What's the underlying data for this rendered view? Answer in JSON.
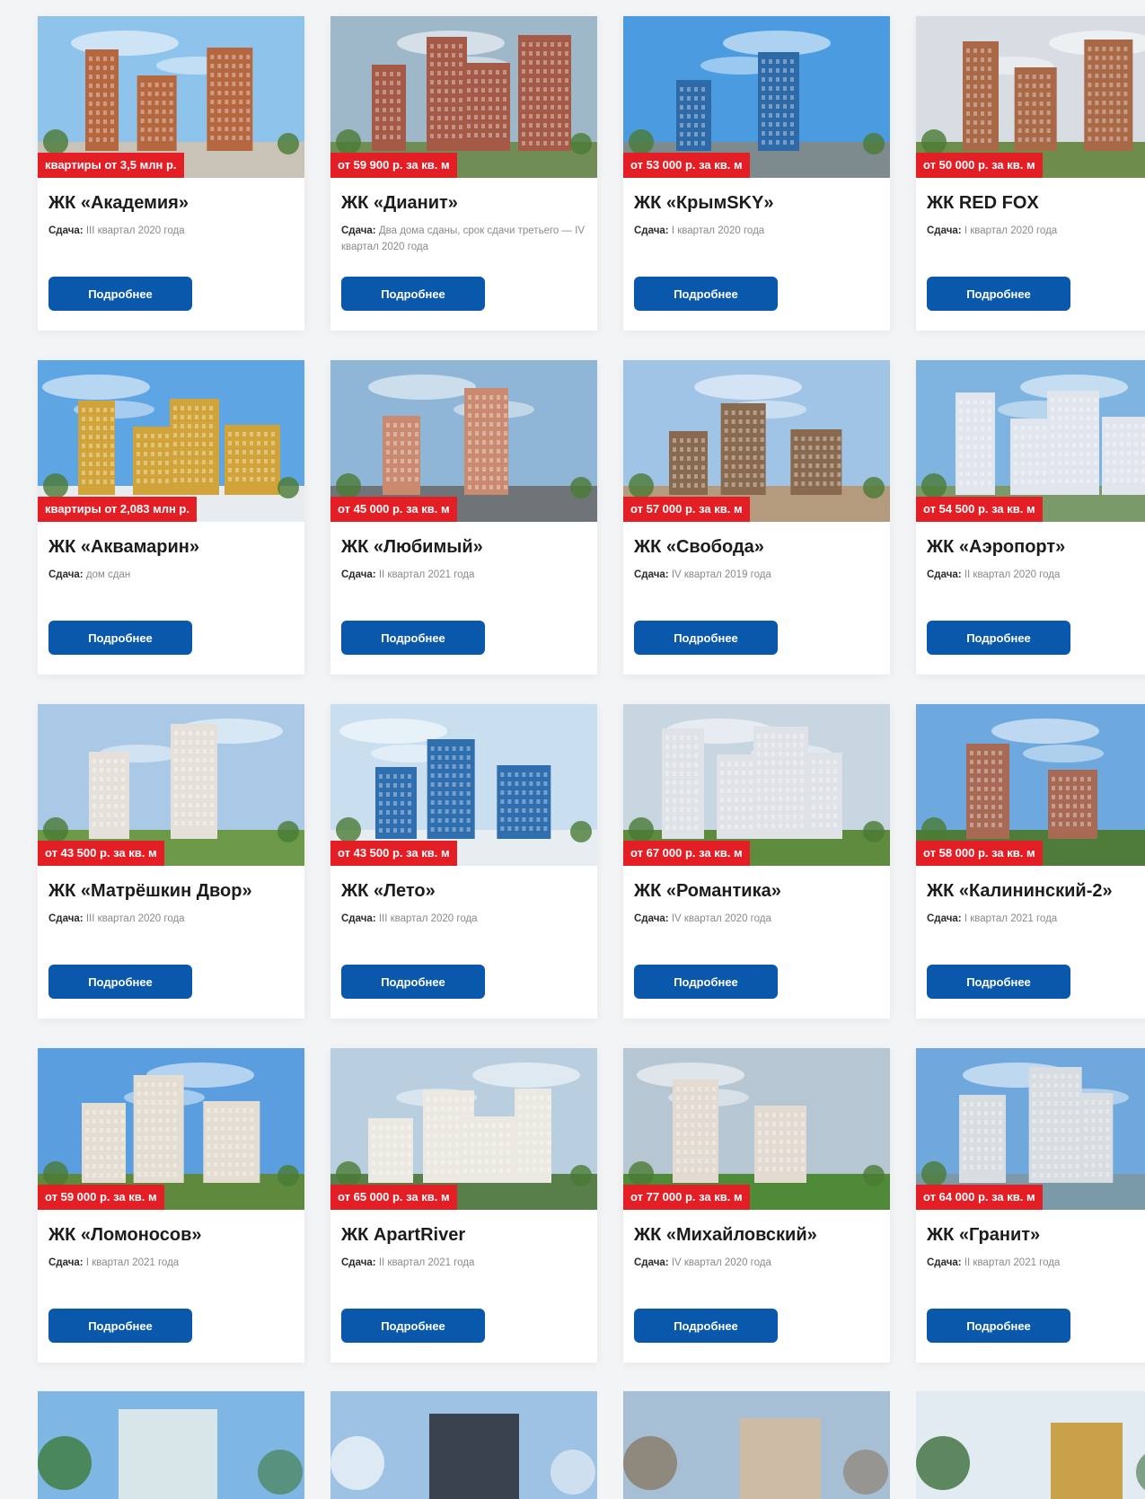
{
  "details_label": "Подробнее",
  "status_label": "Сдача:",
  "cards": [
    {
      "title": "ЖК «Академия»",
      "price": "квартиры от 3,5 млн р.",
      "status": "III квартал 2020 года",
      "sky": "#8ec3ec",
      "ground": "#c9c2b6",
      "building": "#b5673f"
    },
    {
      "title": "ЖК «Дианит»",
      "price": "от 59 900 р. за кв. м",
      "status": "Два дома сданы, срок сдачи третьего — IV квартал 2020 года",
      "sky": "#9fb8c9",
      "ground": "#6f8d55",
      "building": "#a45a46"
    },
    {
      "title": "ЖК «КрымSKY»",
      "price": "от 53 000 р. за кв. м",
      "status": "I квартал 2020 года",
      "sky": "#4a9be0",
      "ground": "#7d8a8e",
      "building": "#2f6aa8"
    },
    {
      "title": "ЖК RED FOX",
      "price": "от 50 000 р. за кв. м",
      "status": "I квартал 2020 года",
      "sky": "#d7dde2",
      "ground": "#6e8c4a",
      "building": "#a96846"
    },
    {
      "title": "ЖК «Аквамарин»",
      "price": "квартиры от 2,083 млн р.",
      "status": "дом сдан",
      "sky": "#5ea5e3",
      "ground": "#e8ecef",
      "building": "#d1a43a"
    },
    {
      "title": "ЖК «Любимый»",
      "price": "от 45 000 р. за кв. м",
      "status": "II квартал 2021 года",
      "sky": "#8fb6d6",
      "ground": "#6f7479",
      "building": "#c98a6f"
    },
    {
      "title": "ЖК «Свобода»",
      "price": "от 57 000 р. за кв. м",
      "status": "IV квартал 2019 года",
      "sky": "#9fc4e6",
      "ground": "#b49b7e",
      "building": "#8a6a4e"
    },
    {
      "title": "ЖК «Аэропорт»",
      "price": "от 54 500 р. за кв. м",
      "status": "II квартал 2020 года",
      "sky": "#7fb3e0",
      "ground": "#7a9a6a",
      "building": "#e1e6ee"
    },
    {
      "title": "ЖК «Матрёшкин Двор»",
      "price": "от 43 500 р. за кв. м",
      "status": "III квартал 2020 года",
      "sky": "#a9c9e6",
      "ground": "#6c9a48",
      "building": "#e6e0da"
    },
    {
      "title": "ЖК «Лето»",
      "price": "от 43 500 р. за кв. м",
      "status": "III квартал 2020 года",
      "sky": "#c9dff0",
      "ground": "#e8edf2",
      "building": "#2f6fb0"
    },
    {
      "title": "ЖК «Романтика»",
      "price": "от 67 000 р. за кв. м",
      "status": "IV квартал 2020 года",
      "sky": "#c8d6e2",
      "ground": "#5e8b3e",
      "building": "#dfe2e6"
    },
    {
      "title": "ЖК «Калининский-2»",
      "price": "от 58 000 р. за кв. м",
      "status": "I квартал 2021 года",
      "sky": "#6da9de",
      "ground": "#4f7c3a",
      "building": "#a86a55"
    },
    {
      "title": "ЖК «Ломоносов»",
      "price": "от 59 000 р. за кв. м",
      "status": "I квартал 2021 года",
      "sky": "#5a9ee0",
      "ground": "#5f8a3e",
      "building": "#e4ddd2"
    },
    {
      "title": "ЖК ApartRiver",
      "price": "от 65 000 р. за кв. м",
      "status": "II квартал 2021 года",
      "sky": "#b9cfe0",
      "ground": "#587f4a",
      "building": "#ece8e2"
    },
    {
      "title": "ЖК «Михайловский»",
      "price": "от 77 000 р. за кв. м",
      "status": "IV квартал 2020 года",
      "sky": "#b6c6d2",
      "ground": "#4f8a38",
      "building": "#e3dbd1"
    },
    {
      "title": "ЖК «Гранит»",
      "price": "от 64 000 р. за кв. м",
      "status": "II квартал 2021 года",
      "sky": "#6ea8dc",
      "ground": "#7a9aa8",
      "building": "#d8dde2"
    }
  ],
  "partial_cards": [
    {
      "sky": "#7fb7e4",
      "building": "#d8e6ea",
      "accent": "#3d7a3a"
    },
    {
      "sky": "#9dc2e4",
      "building": "#3a4250",
      "accent": "#eef2f6"
    },
    {
      "sky": "#a7bfd4",
      "building": "#cdbba5",
      "accent": "#8a7a66"
    },
    {
      "sky": "#e3ebf2",
      "building": "#c9a14a",
      "accent": "#3a6e3a"
    }
  ]
}
